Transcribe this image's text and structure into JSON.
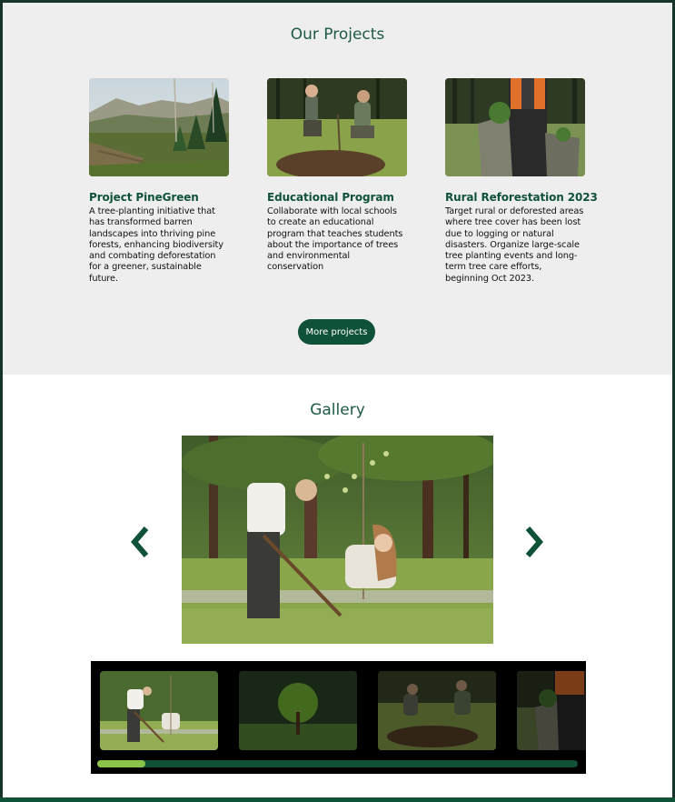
{
  "projects": {
    "title": "Our Projects",
    "cards": [
      {
        "title": "Project PineGreen",
        "description": "A tree-planting initiative that has transformed barren landscapes into thriving pine forests, enhancing biodiversity and combating deforestation for a greener, sustainable future."
      },
      {
        "title": "Educational Program",
        "description": "Collaborate with local schools to create an educational program that teaches students about the importance of trees and environmental conservation"
      },
      {
        "title": "Rural Reforestation 2023",
        "description": "Target rural or deforested areas where tree cover has been lost due to logging or natural disasters. Organize large-scale tree planting events and long-term tree care efforts, beginning Oct 2023."
      }
    ],
    "more_label": "More projects"
  },
  "gallery": {
    "title": "Gallery",
    "prev_icon": "chevron-left-icon",
    "next_icon": "chevron-right-icon",
    "progress": 0.1
  },
  "colors": {
    "accent": "#0f5238",
    "progress": "#8bc34a",
    "section_bg": "#eeeeee"
  }
}
